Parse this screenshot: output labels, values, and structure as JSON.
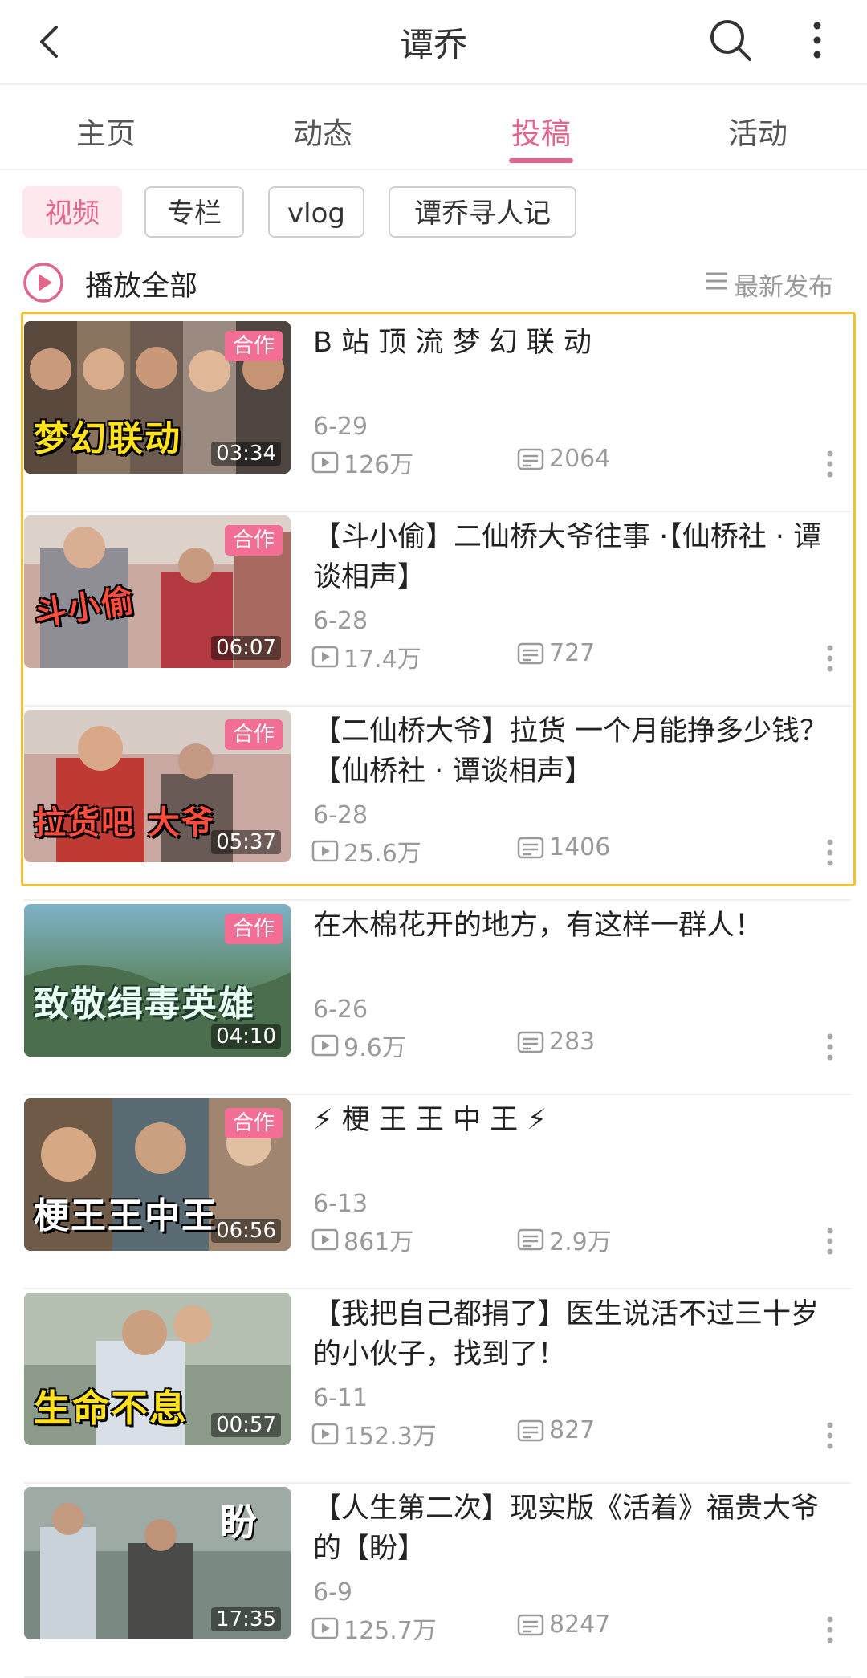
{
  "header": {
    "title": "谭乔"
  },
  "tabs": [
    {
      "label": "主页",
      "active": false
    },
    {
      "label": "动态",
      "active": false
    },
    {
      "label": "投稿",
      "active": true
    },
    {
      "label": "活动",
      "active": false
    }
  ],
  "chips": [
    {
      "label": "视频",
      "active": true
    },
    {
      "label": "专栏",
      "active": false
    },
    {
      "label": "vlog",
      "active": false
    },
    {
      "label": "谭乔寻人记",
      "active": false
    }
  ],
  "toolbar": {
    "play_all": "播放全部",
    "sort": "最新发布"
  },
  "colors": {
    "accent": "#e2668b",
    "highlight": "#f2c232",
    "meta": "#9a9a9a"
  },
  "videos": [
    {
      "thumb_text": "梦幻联动",
      "badge": "合作",
      "duration": "03:34",
      "title": "B 站 顶 流 梦 幻 联 动",
      "date": "6-29",
      "plays": "126万",
      "danmaku": "2064",
      "highlighted": true
    },
    {
      "thumb_text": "斗小偷",
      "badge": "合作",
      "duration": "06:07",
      "title": "【斗小偷】二仙桥大爷往事 ·【仙桥社 · 谭谈相声】",
      "date": "6-28",
      "plays": "17.4万",
      "danmaku": "727",
      "highlighted": true
    },
    {
      "thumb_text": "拉货吧 大爷",
      "badge": "合作",
      "duration": "05:37",
      "title": "【二仙桥大爷】拉货 一个月能挣多少钱？【仙桥社 · 谭谈相声】",
      "date": "6-28",
      "plays": "25.6万",
      "danmaku": "1406",
      "highlighted": true
    },
    {
      "thumb_text": "致敬缉毒英雄",
      "badge": "合作",
      "duration": "04:10",
      "title": "在木棉花开的地方，有这样一群人！",
      "date": "6-26",
      "plays": "9.6万",
      "danmaku": "283",
      "highlighted": false
    },
    {
      "thumb_text": "梗王王中王",
      "badge": "合作",
      "duration": "06:56",
      "title": "⚡ 梗 王 王 中 王 ⚡",
      "date": "6-13",
      "plays": "861万",
      "danmaku": "2.9万",
      "highlighted": false
    },
    {
      "thumb_text": "生命不息",
      "badge": "",
      "duration": "00:57",
      "title": "【我把自己都捐了】医生说活不过三十岁的小伙子，找到了！",
      "date": "6-11",
      "plays": "152.3万",
      "danmaku": "827",
      "highlighted": false
    },
    {
      "thumb_text": "盼",
      "badge": "",
      "duration": "17:35",
      "title": "【人生第二次】现实版《活着》福贵大爷的【盼】",
      "date": "6-9",
      "plays": "125.7万",
      "danmaku": "8247",
      "highlighted": false
    }
  ]
}
